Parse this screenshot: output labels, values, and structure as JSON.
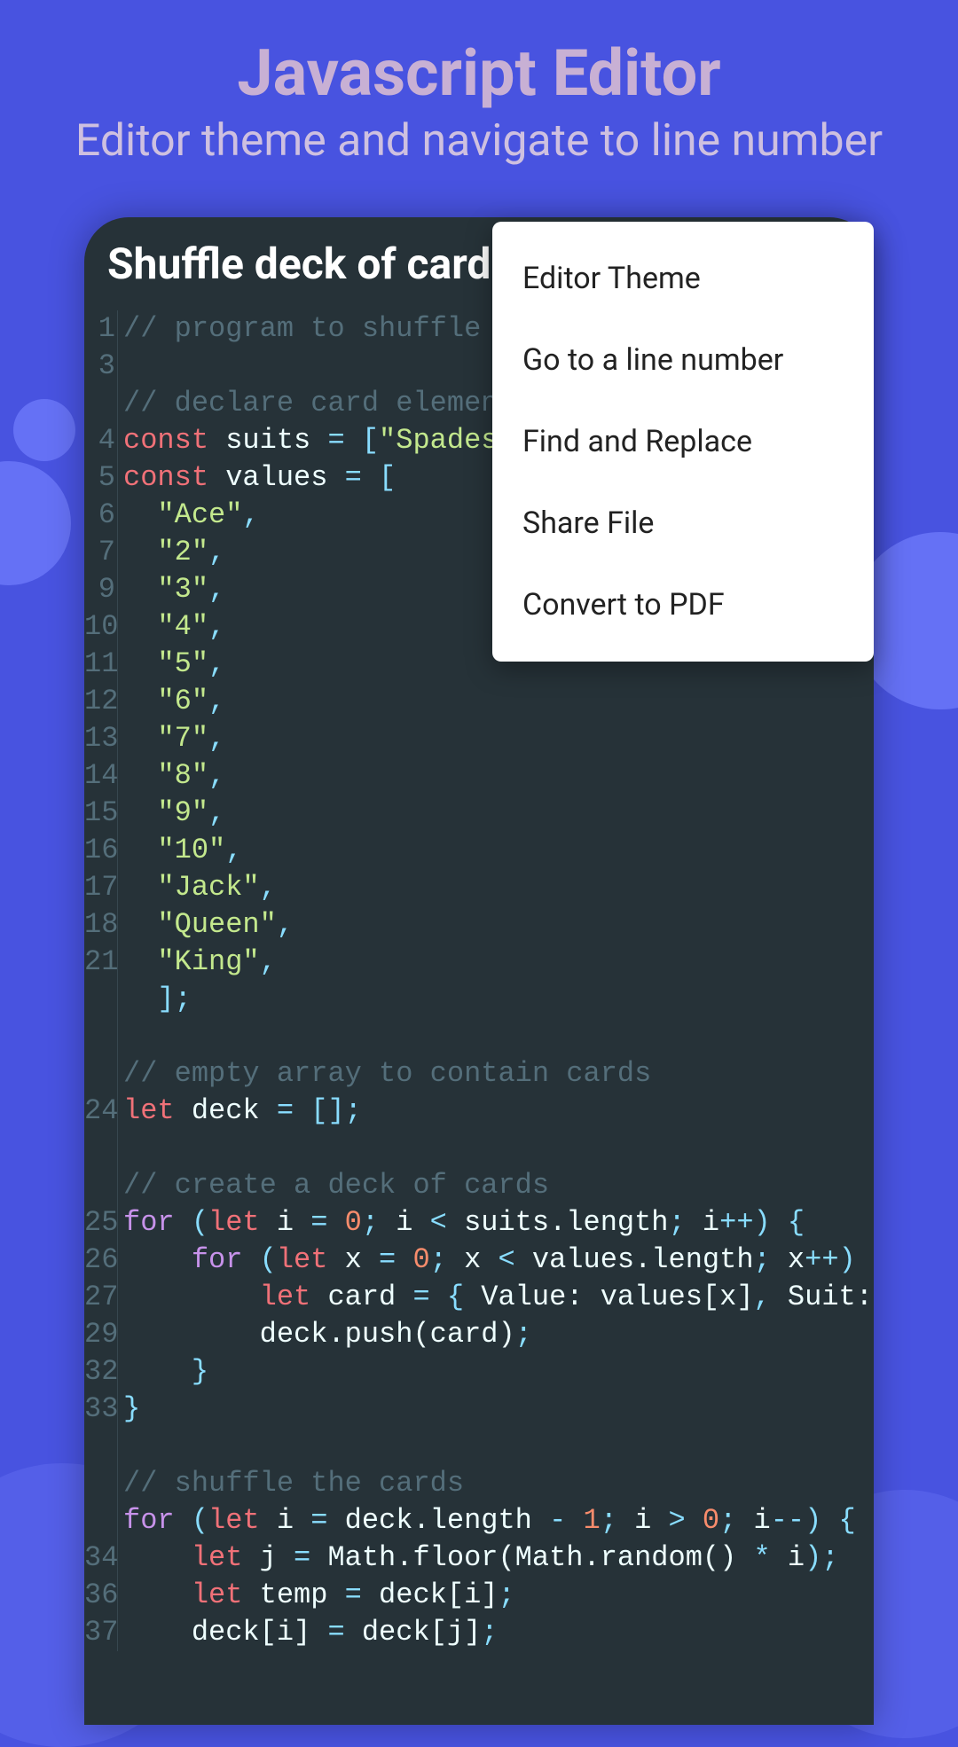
{
  "header": {
    "title": "Javascript Editor",
    "subtitle": "Editor theme and navigate to line number"
  },
  "file": {
    "name": "Shuffle deck of card.js"
  },
  "menu": {
    "items": [
      "Editor Theme",
      "Go to a line number",
      "Find and Replace",
      "Share File",
      "Convert to PDF"
    ]
  },
  "code": {
    "gutter": [
      "1",
      "3",
      "",
      "4",
      "5",
      "6",
      "7",
      "9",
      "10",
      "11",
      "12",
      "13",
      "14",
      "15",
      "16",
      "17",
      "18",
      "21",
      "",
      "",
      "",
      "24",
      "",
      "",
      "25",
      "26",
      "27",
      "29",
      "32",
      "33",
      "",
      "",
      "",
      "34",
      "36",
      "37"
    ],
    "lines": [
      {
        "t": "comment",
        "text": "// program to shuffle the"
      },
      {
        "t": "blank"
      },
      {
        "t": "comment",
        "text": "// declare card elements"
      },
      {
        "t": "const-suits"
      },
      {
        "t": "const-values"
      },
      {
        "t": "string-item",
        "text": "\"Ace\""
      },
      {
        "t": "string-item",
        "text": "\"2\""
      },
      {
        "t": "string-item",
        "text": "\"3\""
      },
      {
        "t": "string-item",
        "text": "\"4\""
      },
      {
        "t": "string-item",
        "text": "\"5\""
      },
      {
        "t": "string-item",
        "text": "\"6\""
      },
      {
        "t": "string-item",
        "text": "\"7\""
      },
      {
        "t": "string-item",
        "text": "\"8\""
      },
      {
        "t": "string-item",
        "text": "\"9\""
      },
      {
        "t": "string-item",
        "text": "\"10\""
      },
      {
        "t": "string-item",
        "text": "\"Jack\""
      },
      {
        "t": "string-item",
        "text": "\"Queen\""
      },
      {
        "t": "string-item",
        "text": "\"King\""
      },
      {
        "t": "close-array"
      },
      {
        "t": "blank"
      },
      {
        "t": "comment",
        "text": "// empty array to contain cards"
      },
      {
        "t": "let-deck"
      },
      {
        "t": "blank"
      },
      {
        "t": "comment",
        "text": "// create a deck of cards"
      },
      {
        "t": "for-i"
      },
      {
        "t": "for-x"
      },
      {
        "t": "let-card"
      },
      {
        "t": "deck-push"
      },
      {
        "t": "close-brace-2"
      },
      {
        "t": "close-brace-1"
      },
      {
        "t": "blank"
      },
      {
        "t": "comment",
        "text": "// shuffle the cards"
      },
      {
        "t": "for-shuffle"
      },
      {
        "t": "let-j"
      },
      {
        "t": "let-temp"
      },
      {
        "t": "deck-swap"
      }
    ],
    "strings": {
      "spades": "\"Spades\""
    }
  }
}
